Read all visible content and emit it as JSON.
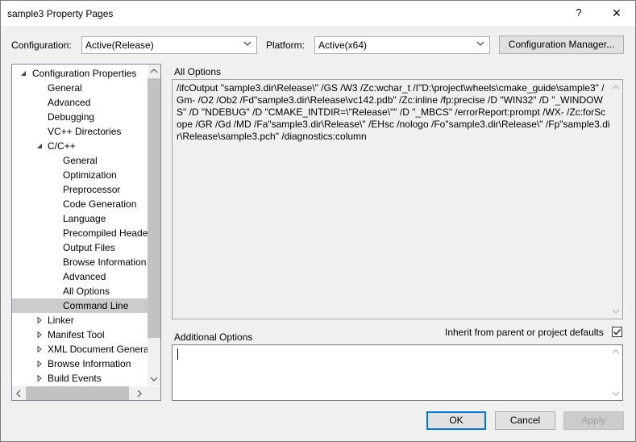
{
  "window": {
    "title": "sample3 Property Pages",
    "help_glyph": "?",
    "close_glyph": "✕"
  },
  "config": {
    "configuration_label": "Configuration:",
    "configuration_value": "Active(Release)",
    "platform_label": "Platform:",
    "platform_value": "Active(x64)",
    "manager_button": "Configuration Manager..."
  },
  "tree": {
    "items": [
      {
        "label": "Configuration Properties",
        "expander": "expanded"
      },
      {
        "label": "General"
      },
      {
        "label": "Advanced"
      },
      {
        "label": "Debugging"
      },
      {
        "label": "VC++ Directories"
      },
      {
        "label": "C/C++",
        "expander": "expanded"
      },
      {
        "label": "General"
      },
      {
        "label": "Optimization"
      },
      {
        "label": "Preprocessor"
      },
      {
        "label": "Code Generation"
      },
      {
        "label": "Language"
      },
      {
        "label": "Precompiled Heade"
      },
      {
        "label": "Output Files"
      },
      {
        "label": "Browse Information"
      },
      {
        "label": "Advanced"
      },
      {
        "label": "All Options"
      },
      {
        "label": "Command Line",
        "selected": true
      },
      {
        "label": "Linker",
        "expander": "collapsed"
      },
      {
        "label": "Manifest Tool",
        "expander": "collapsed"
      },
      {
        "label": "XML Document Genera",
        "expander": "collapsed"
      },
      {
        "label": "Browse Information",
        "expander": "collapsed"
      },
      {
        "label": "Build Events",
        "expander": "collapsed"
      }
    ]
  },
  "all_options": {
    "label": "All Options",
    "text": "/ifcOutput \"sample3.dir\\Release\\\" /GS /W3 /Zc:wchar_t /I\"D:\\project\\wheels\\cmake_guide\\sample3\" /Gm- /O2 /Ob2 /Fd\"sample3.dir\\Release\\vc142.pdb\" /Zc:inline /fp:precise /D \"WIN32\" /D \"_WINDOWS\" /D \"NDEBUG\" /D \"CMAKE_INTDIR=\\\"Release\\\"\" /D \"_MBCS\" /errorReport:prompt /WX- /Zc:forScope /GR /Gd /MD /Fa\"sample3.dir\\Release\\\" /EHsc /nologo /Fo\"sample3.dir\\Release\\\" /Fp\"sample3.dir\\Release\\sample3.pch\" /diagnostics:column"
  },
  "additional_options": {
    "label": "Additional Options",
    "value": "",
    "inherit_label": "Inherit from parent or project defaults",
    "inherit_checked": true
  },
  "buttons": {
    "ok": "OK",
    "cancel": "Cancel",
    "apply": "Apply"
  },
  "colors": {
    "accent": "#0078d7",
    "selection": "#cccccc"
  }
}
